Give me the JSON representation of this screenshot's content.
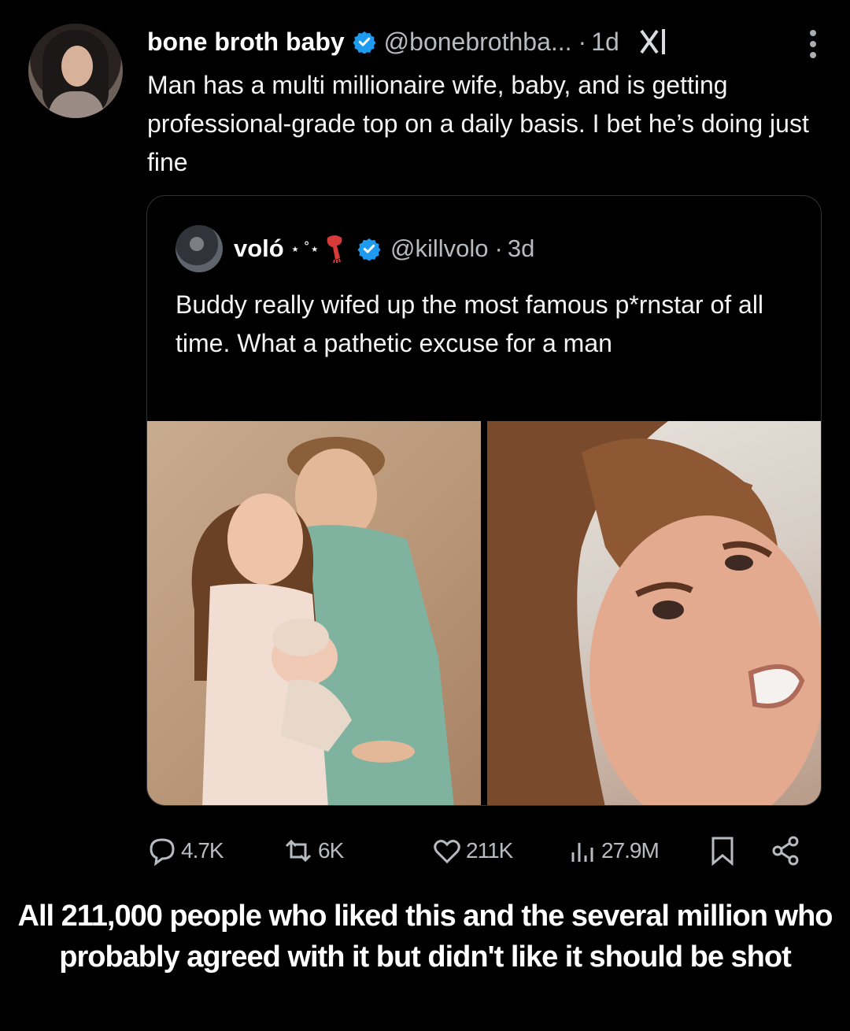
{
  "tweet": {
    "author_name": "bone broth baby",
    "handle": "@bonebrothba...",
    "separator": "·",
    "time": "1d",
    "text": "Man has a multi millionaire wife, baby, and is getting professional-grade top on a daily basis. I bet he’s doing just fine"
  },
  "quoted_tweet": {
    "author_name": "voló",
    "name_decoration": "⋆ ˚⋆",
    "handle": "@killvolo",
    "separator": "·",
    "time": "3d",
    "text": "Buddy really wifed up the most famous p*rnstar of all time. What a pathetic excuse for a man"
  },
  "stats": {
    "replies": "4.7K",
    "reposts": "6K",
    "likes": "211K",
    "views": "27.9M"
  },
  "caption": "All 211,000 people who liked this and the several million who probably agreed with it but didn't like it should be shot",
  "colors": {
    "background": "#000000",
    "verified": "#1d9bf0",
    "muted_text": "#b7bcc1"
  }
}
